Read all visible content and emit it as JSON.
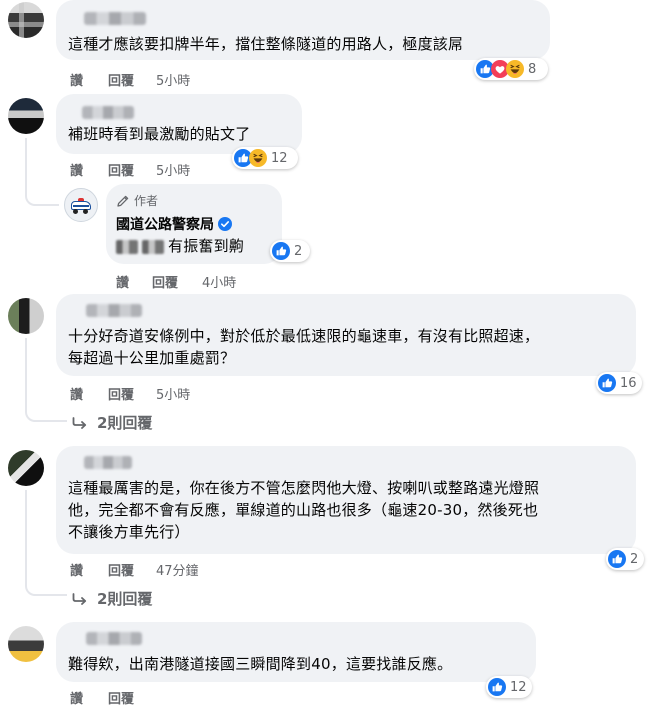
{
  "labels": {
    "like": "讚",
    "reply": "回覆"
  },
  "colors": {
    "bubble": "#f0f2f5",
    "secondary_text": "#65676b",
    "like_blue": "#1877f2",
    "love_red": "#f33e58",
    "haha_yellow": "#f7b928",
    "verified_blue": "#1877f2"
  },
  "comments": [
    {
      "text": "這種才應該要扣牌半年，擋住整條隧道的用路人，極度該屌",
      "time": "5小時",
      "reactions": [
        "like-icon",
        "love-icon",
        "haha-icon"
      ],
      "reaction_count": "8"
    },
    {
      "text": "補班時看到最激勵的貼文了",
      "time": "5小時",
      "reactions": [
        "like-icon",
        "haha-icon"
      ],
      "reaction_count": "12",
      "reply": {
        "author_tag": "作者",
        "page_name": "國道公路警察局",
        "verified": true,
        "text": "有振奮到齁",
        "time": "4小時",
        "reactions": [
          "like-icon"
        ],
        "reaction_count": "2"
      }
    },
    {
      "text_lines": [
        "十分好奇道安條例中，對於低於最低速限的龜速車，有沒有比照超速，",
        "每超過十公里加重處罰？"
      ],
      "time": "5小時",
      "reactions": [
        "like-icon"
      ],
      "reaction_count": "16",
      "more_replies": "2則回覆"
    },
    {
      "text_lines": [
        "這種最厲害的是，你在後方不管怎麼閃他大燈、按喇叭或整路遠光燈照",
        "他，完全都不會有反應，單線道的山路也很多（龜速20-30，然後死也",
        "不讓後方車先行）"
      ],
      "time": "47分鐘",
      "reactions": [
        "like-icon"
      ],
      "reaction_count": "2",
      "more_replies": "2則回覆"
    },
    {
      "text": "難得欸，出南港隧道接國三瞬間降到40，這要找誰反應。",
      "reactions": [
        "like-icon"
      ],
      "reaction_count": "12"
    }
  ]
}
